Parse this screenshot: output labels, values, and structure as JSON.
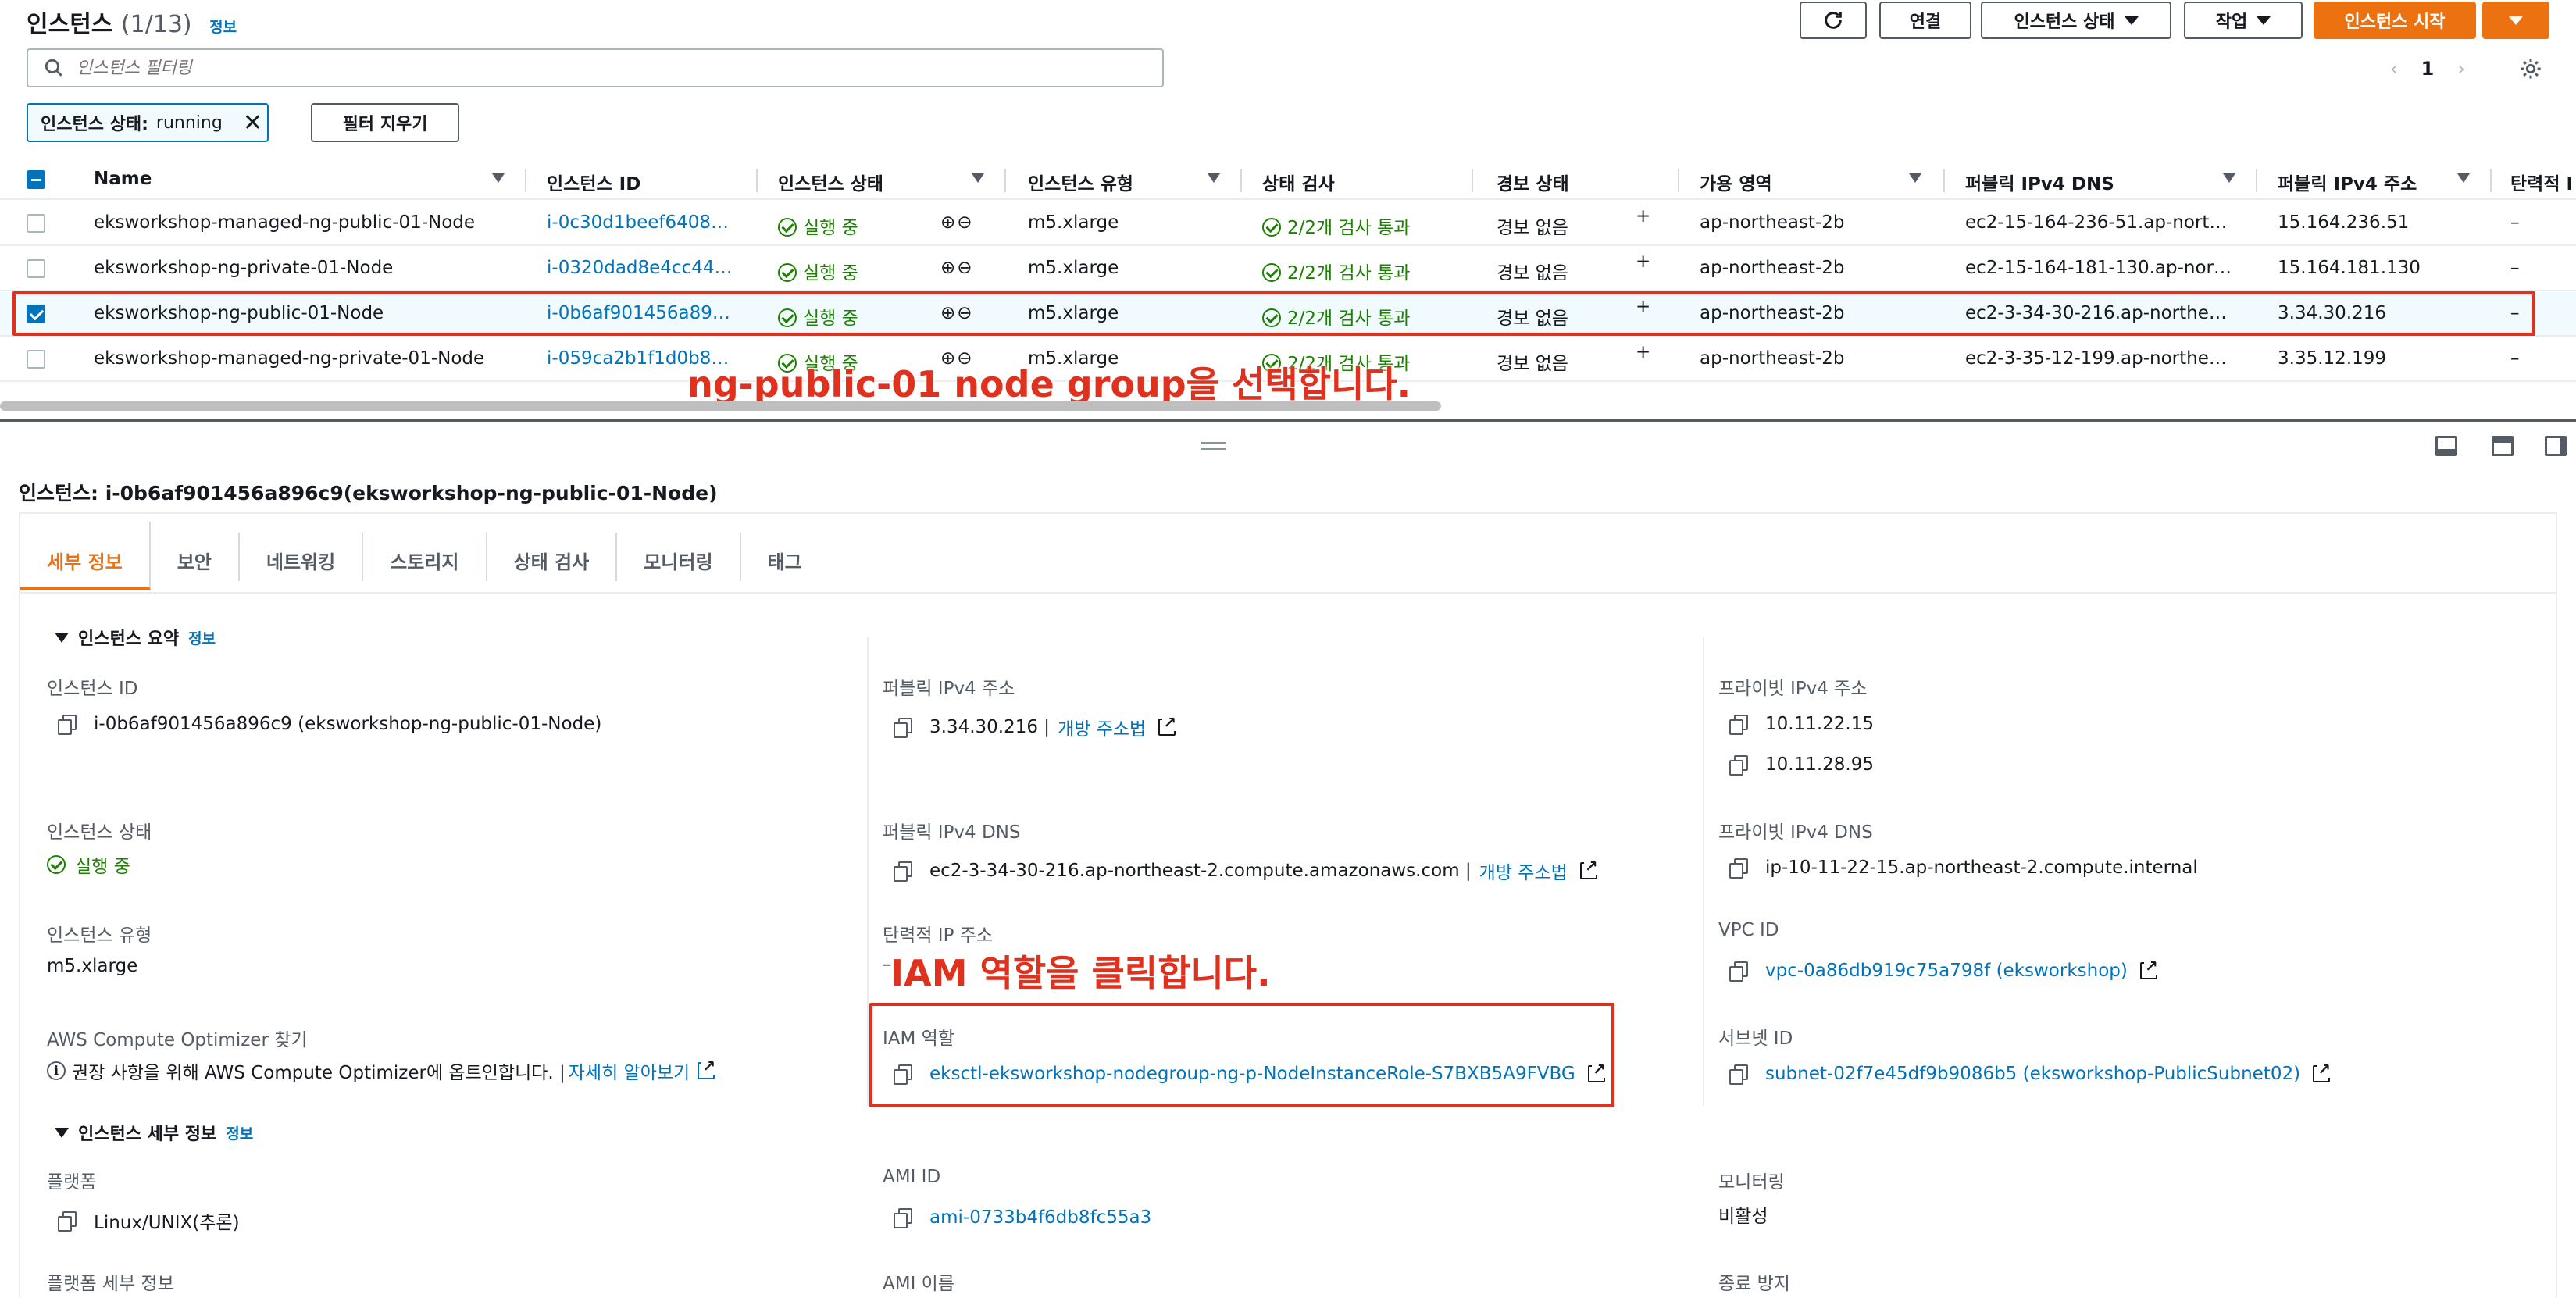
{
  "header": {
    "title": "인스턴스",
    "count": "(1/13)",
    "info": "정보",
    "refresh_icon": "refresh-icon",
    "connect_label": "연결",
    "instance_state_label": "인스턴스 상태",
    "actions_label": "작업",
    "launch_label": "인스턴스 시작"
  },
  "search": {
    "placeholder": "인스턴스 필터링"
  },
  "pagination": {
    "page": "1"
  },
  "filter": {
    "key": "인스턴스 상태:",
    "value": "running",
    "clear_label": "필터 지우기"
  },
  "table": {
    "columns": [
      "Name",
      "인스턴스 ID",
      "인스턴스 상태",
      "인스턴스 유형",
      "상태 검사",
      "경보 상태",
      "가용 영역",
      "퍼블릭 IPv4 DNS",
      "퍼블릭 IPv4 주소",
      "탄력적 I"
    ],
    "rows": [
      {
        "name": "eksworkshop-managed-ng-public-01-Node",
        "id": "i-0c30d1beef6408…",
        "state": "실행 중",
        "type": "m5.xlarge",
        "check": "2/2개 검사 통과",
        "alarm": "경보 없음",
        "az": "ap-northeast-2b",
        "dns": "ec2-15-164-236-51.ap-nort…",
        "ip": "15.164.236.51",
        "eip": "–",
        "selected": false
      },
      {
        "name": "eksworkshop-ng-private-01-Node",
        "id": "i-0320dad8e4cc44…",
        "state": "실행 중",
        "type": "m5.xlarge",
        "check": "2/2개 검사 통과",
        "alarm": "경보 없음",
        "az": "ap-northeast-2b",
        "dns": "ec2-15-164-181-130.ap-nor…",
        "ip": "15.164.181.130",
        "eip": "–",
        "selected": false
      },
      {
        "name": "eksworkshop-ng-public-01-Node",
        "id": "i-0b6af901456a89…",
        "state": "실행 중",
        "type": "m5.xlarge",
        "check": "2/2개 검사 통과",
        "alarm": "경보 없음",
        "az": "ap-northeast-2b",
        "dns": "ec2-3-34-30-216.ap-northe…",
        "ip": "3.34.30.216",
        "eip": "–",
        "selected": true
      },
      {
        "name": "eksworkshop-managed-ng-private-01-Node",
        "id": "i-059ca2b1f1d0b8…",
        "state": "실행 중",
        "type": "m5.xlarge",
        "check": "2/2개 검사 통과",
        "alarm": "경보 없음",
        "az": "ap-northeast-2b",
        "dns": "ec2-3-35-12-199.ap-northe…",
        "ip": "3.35.12.199",
        "eip": "–",
        "selected": false
      }
    ]
  },
  "annotations": {
    "select_node_group": "ng-public-01 node group을 선택합니다.",
    "click_iam_role": "IAM 역할을 클릭합니다."
  },
  "detail": {
    "title": "인스턴스: i-0b6af901456a896c9(eksworkshop-ng-public-01-Node)",
    "tabs": [
      "세부 정보",
      "보안",
      "네트워킹",
      "스토리지",
      "상태 검사",
      "모니터링",
      "태그"
    ],
    "summary_header": "인스턴스 요약",
    "info": "정보",
    "instance_id_label": "인스턴스 ID",
    "instance_id_value": "i-0b6af901456a896c9 (eksworkshop-ng-public-01-Node)",
    "public_ip_label": "퍼블릭 IPv4 주소",
    "public_ip_value": "3.34.30.216 |",
    "open_address": "개방 주소법",
    "private_ip_label": "프라이빗 IPv4 주소",
    "private_ip_1": "10.11.22.15",
    "private_ip_2": "10.11.28.95",
    "state_label": "인스턴스 상태",
    "state_value": "실행 중",
    "public_dns_label": "퍼블릭 IPv4 DNS",
    "public_dns_value": "ec2-3-34-30-216.ap-northeast-2.compute.amazonaws.com |",
    "private_dns_label": "프라이빗 IPv4 DNS",
    "private_dns_value": "ip-10-11-22-15.ap-northeast-2.compute.internal",
    "type_label": "인스턴스 유형",
    "type_value": "m5.xlarge",
    "eip_label": "탄력적 IP 주소",
    "eip_value": "–",
    "vpc_label": "VPC ID",
    "vpc_value": "vpc-0a86db919c75a798f (eksworkshop)",
    "optimizer_label": "AWS Compute Optimizer 찾기",
    "optimizer_text": "권장 사항을 위해 AWS Compute Optimizer에 옵트인합니다. |",
    "learn_more": "자세히 알아보기",
    "iam_label": "IAM 역할",
    "iam_value": "eksctl-eksworkshop-nodegroup-ng-p-NodeInstanceRole-S7BXB5A9FVBG",
    "subnet_label": "서브넷 ID",
    "subnet_value": "subnet-02f7e45df9b9086b5 (eksworkshop-PublicSubnet02)",
    "details_header": "인스턴스 세부 정보",
    "platform_label": "플랫폼",
    "platform_value": "Linux/UNIX(추론)",
    "ami_id_label": "AMI ID",
    "ami_id_value": "ami-0733b4f6db8fc55a3",
    "monitoring_label": "모니터링",
    "monitoring_value": "비활성",
    "platform_detail_label": "플랫폼 세부 정보",
    "ami_name_label": "AMI 이름",
    "termination_label": "종료 방지"
  },
  "colors": {
    "accent": "#ec7211",
    "link": "#0073bb",
    "success": "#1d8102",
    "highlight": "#e0301e"
  }
}
